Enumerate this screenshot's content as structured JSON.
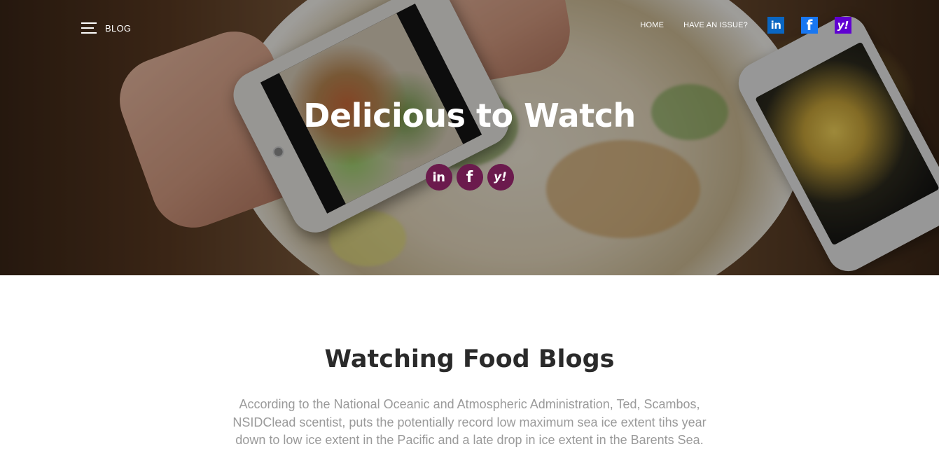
{
  "nav": {
    "brand": "BLOG",
    "links": [
      "HOME",
      "HAVE AN ISSUE?"
    ],
    "social": [
      {
        "name": "linkedin",
        "glyph": "in",
        "color": "#0a66c2"
      },
      {
        "name": "facebook",
        "glyph": "f",
        "color": "#1877f2"
      },
      {
        "name": "yahoo",
        "glyph": "y!",
        "color": "#6001d2"
      }
    ]
  },
  "hero": {
    "title": "Delicious to Watch",
    "social": [
      {
        "name": "linkedin",
        "glyph": "in"
      },
      {
        "name": "facebook",
        "glyph": "f"
      },
      {
        "name": "yahoo",
        "glyph": "y!"
      }
    ],
    "social_color": "#6b1a4d"
  },
  "content": {
    "title": "Watching Food Blogs",
    "body": "According to the National Oceanic and Atmospheric Administration, Ted, Scambos, NSIDClead scentist, puts the potentially record low maximum sea ice extent tihs year down to low ice extent in the Pacific and a late drop in ice extent in the Barents Sea."
  }
}
